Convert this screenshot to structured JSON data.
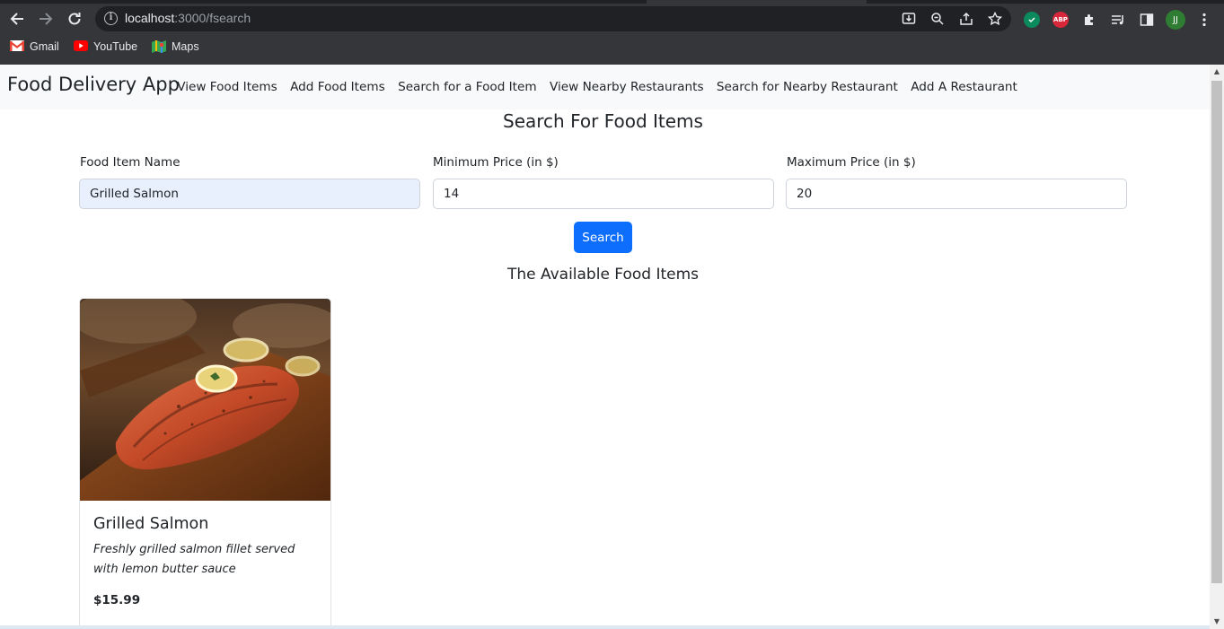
{
  "browser": {
    "url_host": "localhost",
    "url_path": ":3000/fsearch",
    "profile_initials": "JJ",
    "extensions": {
      "abp_label": "ABP"
    },
    "bookmarks": [
      {
        "label": "Gmail",
        "icon": "gmail-icon"
      },
      {
        "label": "YouTube",
        "icon": "youtube-icon"
      },
      {
        "label": "Maps",
        "icon": "maps-icon"
      }
    ]
  },
  "navbar": {
    "brand": "Food Delivery App",
    "links": [
      "View Food Items",
      "Add Food Items",
      "Search for a Food Item",
      "View Nearby Restaurants",
      "Search for Nearby Restaurant",
      "Add A Restaurant"
    ]
  },
  "search_form": {
    "title": "Search For Food Items",
    "name_label": "Food Item Name",
    "name_value": "Grilled Salmon",
    "min_label": "Minimum Price (in $)",
    "min_value": "14",
    "max_label": "Maximum Price (in $)",
    "max_value": "20",
    "button_label": "Search"
  },
  "results": {
    "title": "The Available Food Items",
    "items": [
      {
        "name": "Grilled Salmon",
        "description": "Freshly grilled salmon fillet served with lemon butter sauce",
        "price": "$15.99"
      }
    ]
  },
  "colors": {
    "primary": "#0d6efd",
    "navbar_bg": "#f8f9fa",
    "chrome_bg": "#35363a"
  }
}
